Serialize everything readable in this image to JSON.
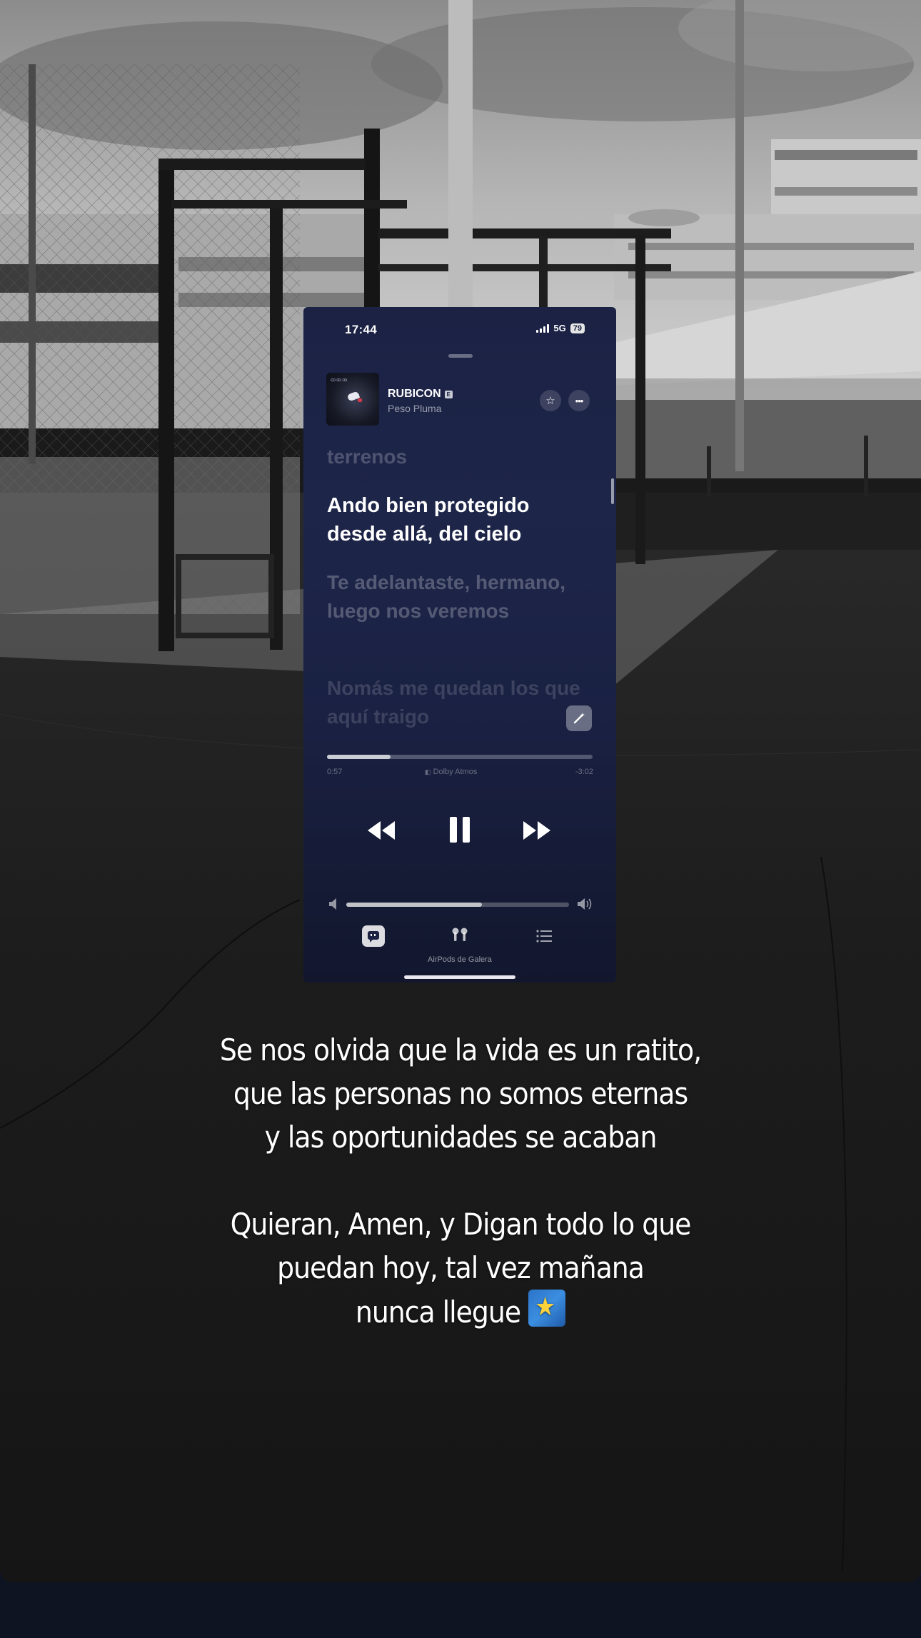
{
  "phone": {
    "status_time": "17:44",
    "network": "5G",
    "battery": "79",
    "now_playing": {
      "title": "RUBICON",
      "explicit_mark": "E",
      "artist": "Peso Pluma",
      "album_art_text": "ꝏꝏꝏ"
    },
    "icons": {
      "favorite": "star-icon",
      "more": "ellipsis-icon",
      "lyrics_ai": "magic-wand-icon",
      "rewind": "rewind-icon",
      "pause": "pause-icon",
      "forward": "fast-forward-icon",
      "volume_low": "speaker-low-icon",
      "volume_high": "speaker-high-icon",
      "lyrics": "lyrics-quote-icon",
      "airplay": "airpods-icon",
      "queue": "list-icon"
    },
    "lyrics": {
      "previous": "terrenos",
      "current": "Ando bien protegido desde allá, del cielo",
      "next": "Te adelantaste, hermano, luego nos veremos",
      "next2": "Nomás me quedan los que aquí traigo"
    },
    "progress": {
      "elapsed": "0:57",
      "remaining": "-3:02",
      "fraction": 0.24,
      "format": "Dolby Atmos"
    },
    "volume_fraction": 0.61,
    "output_device": "AirPods de Galera"
  },
  "caption": {
    "line1": "Se nos olvida que la vida es un ratito,",
    "line2": "que las personas no somos eternas",
    "line3": "y las oportunidades se acaban",
    "line4": "Quieran, Amen, y Digan todo lo que",
    "line5": "puedan hoy, tal vez mañana",
    "line6": "nunca llegue",
    "emoji": "shooting-star-emoji"
  },
  "colors": {
    "phone_bg": "#1b2244",
    "bottom_bar": "#0e1422",
    "star_gold": "#ffd23a"
  }
}
